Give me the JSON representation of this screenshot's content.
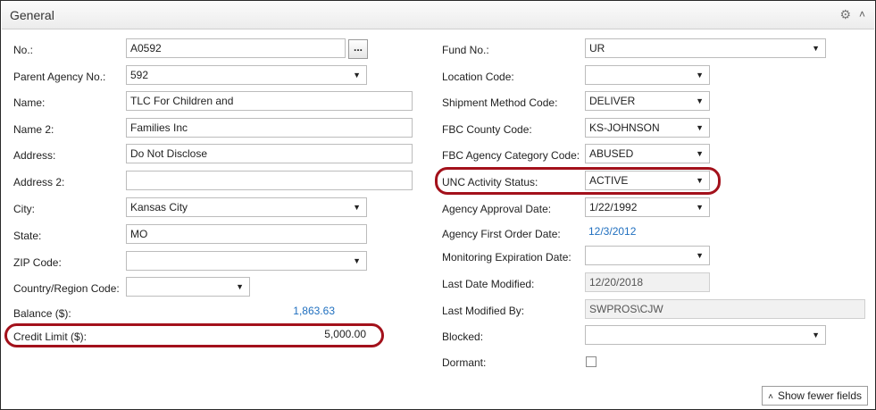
{
  "section": {
    "title": "General"
  },
  "icons": {
    "settings": "gear-icon",
    "collapse": "chevron-up-icon",
    "dropdown": "dropdown-arrow-icon"
  },
  "left": {
    "no": {
      "label": "No.:",
      "value": "A0592",
      "lookup_label": "..."
    },
    "parent_agency_no": {
      "label": "Parent Agency No.:",
      "value": "592"
    },
    "name": {
      "label": "Name:",
      "value": "TLC For Children and"
    },
    "name2": {
      "label": "Name 2:",
      "value": "Families  Inc"
    },
    "address": {
      "label": "Address:",
      "value": "Do Not Disclose"
    },
    "address2": {
      "label": "Address 2:",
      "value": ""
    },
    "city": {
      "label": "City:",
      "value": "Kansas City"
    },
    "state": {
      "label": "State:",
      "value": "MO"
    },
    "zip": {
      "label": "ZIP Code:",
      "value": ""
    },
    "country": {
      "label": "Country/Region Code:",
      "value": ""
    },
    "balance": {
      "label": "Balance ($):",
      "value": "1,863.63"
    },
    "credit_limit": {
      "label": "Credit Limit ($):",
      "value": "5,000.00"
    }
  },
  "right": {
    "fund_no": {
      "label": "Fund No.:",
      "value": "UR"
    },
    "location_code": {
      "label": "Location Code:",
      "value": ""
    },
    "shipment_method": {
      "label": "Shipment Method Code:",
      "value": "DELIVER"
    },
    "fbc_county": {
      "label": "FBC County Code:",
      "value": "KS-JOHNSON"
    },
    "fbc_agency_category": {
      "label": "FBC Agency Category Code:",
      "value": "ABUSED"
    },
    "unc_activity_status": {
      "label": "UNC Activity Status:",
      "value": "ACTIVE"
    },
    "agency_approval_date": {
      "label": "Agency Approval Date:",
      "value": "1/22/1992"
    },
    "agency_first_order_date": {
      "label": "Agency First Order Date:",
      "value": "12/3/2012"
    },
    "monitoring_expiration": {
      "label": "Monitoring Expiration Date:",
      "value": ""
    },
    "last_date_modified": {
      "label": "Last Date Modified:",
      "value": "12/20/2018"
    },
    "last_modified_by": {
      "label": "Last Modified By:",
      "value": "SWPROS\\CJW"
    },
    "blocked": {
      "label": "Blocked:",
      "value": ""
    },
    "dormant": {
      "label": "Dormant:",
      "checked": false
    }
  },
  "footer": {
    "show_fewer_label": "Show fewer fields"
  },
  "colors": {
    "highlight_oval": "#a3111b",
    "link": "#1f6fbf"
  }
}
